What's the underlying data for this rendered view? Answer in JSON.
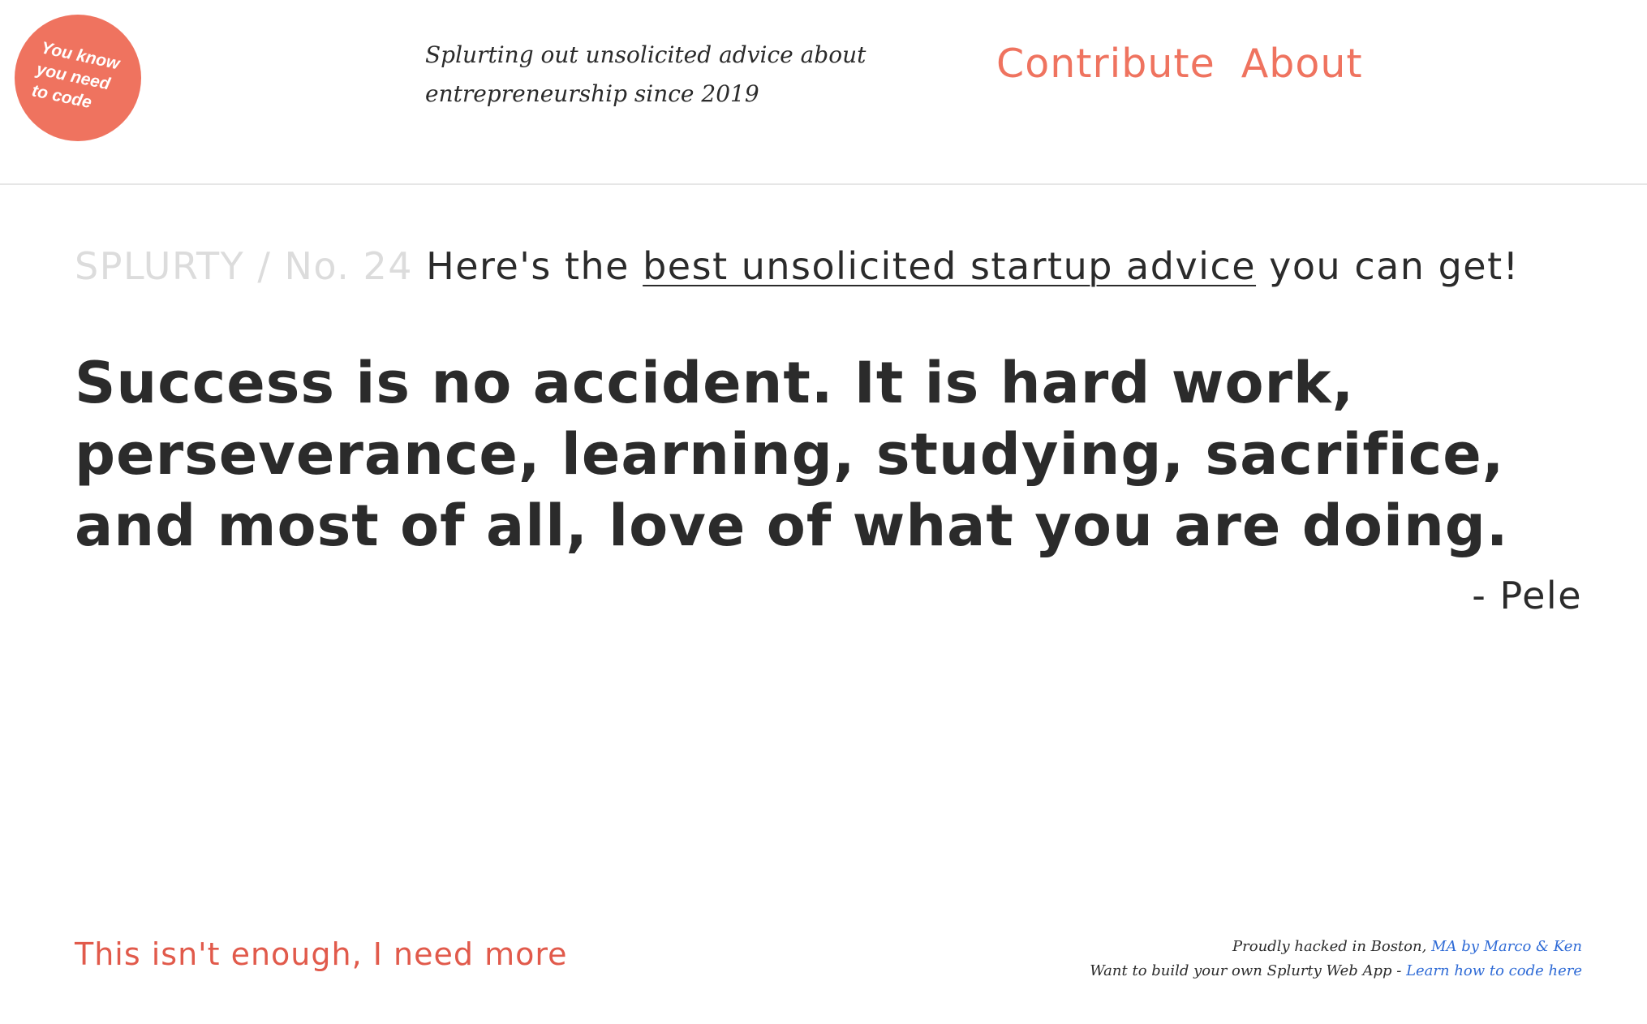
{
  "header": {
    "badge_text": "You know\nyou need\nto code",
    "badge_color": "#ef735f",
    "tagline_line1": "Splurting out unsolicited advice about",
    "tagline_line2": "entrepreneurship since 2019",
    "nav": {
      "contribute": "Contribute",
      "about": "About"
    }
  },
  "main": {
    "brand": "SPLURTY / No. 24",
    "intro_before": "Here's the",
    "intro_link": "best unsolicited startup advice",
    "intro_after": "you can get!",
    "quote_lines": [
      "Success is no accident. It is hard work,",
      "perseverance, learning, studying, sacrifice,",
      "and most of all, love of what you are doing."
    ],
    "author": "- Pele"
  },
  "footer": {
    "more_link": "This isn't enough, I need more",
    "credit_line1_text": "Proudly hacked in Boston,",
    "credit_line1_link": "MA by Marco & Ken",
    "credit_line2_text": "Want to build your own Splurty Web App -",
    "credit_line2_link": "Learn how to code here"
  },
  "colors": {
    "accent": "#ef735f",
    "more_link": "#e15a4b",
    "brand_gray": "#dcdcdc",
    "text": "#2b2b2b",
    "footer_link": "#2f6bd6"
  }
}
